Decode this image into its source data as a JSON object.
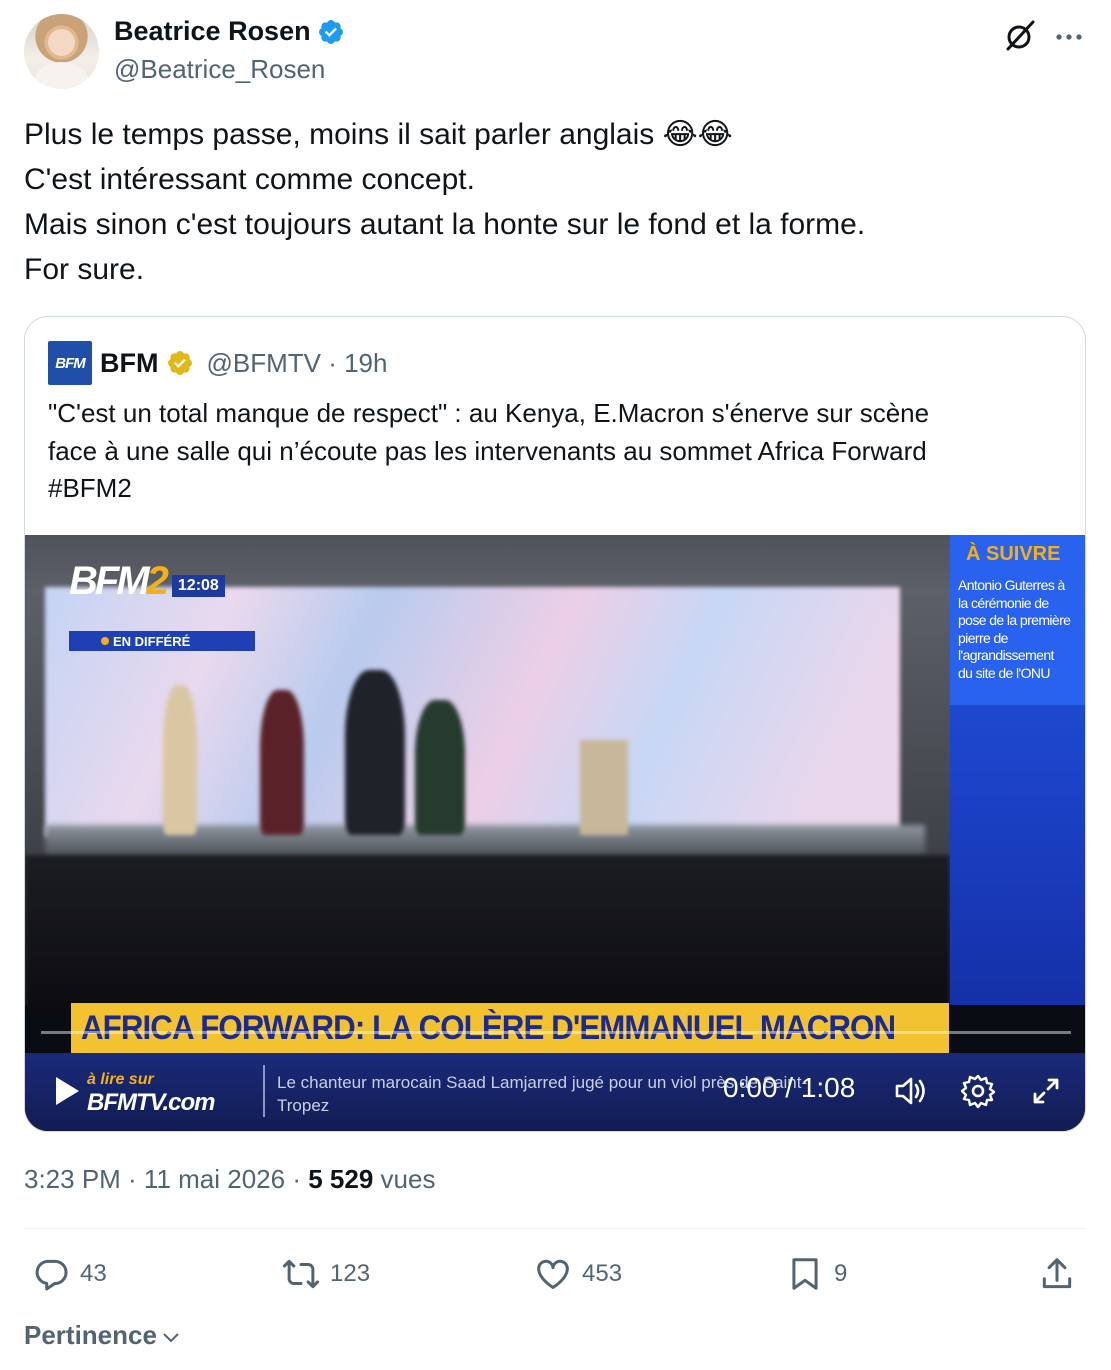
{
  "author": {
    "name": "Beatrice Rosen",
    "handle": "@Beatrice_Rosen",
    "verified_color": "#1d9bf0"
  },
  "tweet": {
    "lines": [
      "Plus le temps passe, moins il sait parler anglais 😂😂",
      "C'est intéressant comme concept.",
      "Mais sinon c'est toujours autant la honte sur le fond et la forme.",
      "For sure."
    ]
  },
  "quote": {
    "avatar_text": "BFM",
    "name": "BFM",
    "handle_time": "@BFMTV · 19h",
    "check_color": "#e2b719",
    "lines": [
      "\"C'est un total manque de respect\" : au Kenya, E.Macron s'énerve sur scène",
      "face à une salle qui n’écoute pas les intervenants au sommet Africa Forward",
      "#BFM2"
    ]
  },
  "video": {
    "channel_main": "BFM",
    "channel_num": "2",
    "clock": "12:08",
    "status": "EN DIFFÉRÉ",
    "next_title": "À SUIVRE",
    "next_lines": [
      "Antonio Guterres à",
      "la cérémonie de",
      "pose de la première",
      "pierre de",
      "l'agrandissement",
      "du site de l'ONU"
    ],
    "banner": "AFRICA FORWARD: LA COLÈRE D'EMMANUEL MACRON",
    "read_on": "à lire sur",
    "site": "BFMTV.com",
    "ticker_lines": [
      "Le chanteur marocain Saad Lamjarred jugé pour un viol près de Saint-",
      "Tropez"
    ],
    "time": "0:00 / 1:08",
    "progress": 0.0
  },
  "meta": {
    "time": "3:23 PM · 11 mai 2026 · ",
    "views": "5 529",
    "views_label": " vues"
  },
  "actions": {
    "replies": "43",
    "reposts": "123",
    "likes": "453",
    "bookmarks": "9"
  },
  "sort": {
    "label": "Pertinence"
  }
}
